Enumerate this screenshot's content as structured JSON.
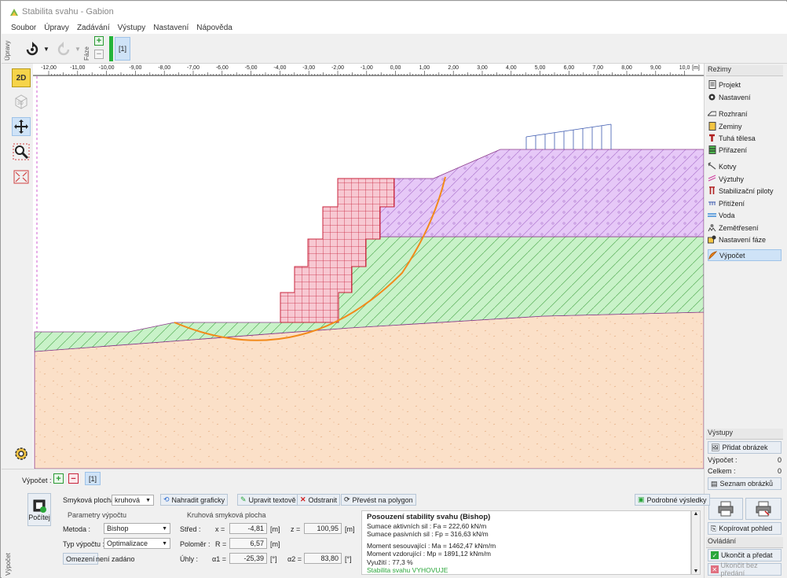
{
  "window": {
    "title": "Stabilita svahu - Gabion"
  },
  "menu": {
    "items": [
      "Soubor",
      "Úpravy",
      "Zadávání",
      "Výstupy",
      "Nastavení",
      "Nápověda"
    ]
  },
  "toolbar": {
    "side_label": "Úpravy",
    "phase_label": "Fáze",
    "phase_tab": "[1]"
  },
  "left_tools": {
    "btn_2d": "2D",
    "btn_3d": "3D"
  },
  "ruler": {
    "unit": "[m]",
    "ticks": [
      "-12,00",
      "-11,00",
      "-10,00",
      "-9,00",
      "-8,00",
      "-7,00",
      "-6,00",
      "-5,00",
      "-4,00",
      "-3,00",
      "-2,00",
      "-1,00",
      "0,00",
      "1,00",
      "2,00",
      "3,00",
      "4,00",
      "5,00",
      "6,00",
      "7,00",
      "8,00",
      "9,00",
      "10,0"
    ]
  },
  "modes": {
    "header": "Režimy",
    "items": [
      "Projekt",
      "Nastavení",
      "Rozhraní",
      "Zeminy",
      "Tuhá tělesa",
      "Přiřazení",
      "Kotvy",
      "Výztuhy",
      "Stabilizační piloty",
      "Přitížení",
      "Voda",
      "Zemětřesení",
      "Nastavení fáze",
      "Výpočet"
    ],
    "active": "Výpočet"
  },
  "outputs": {
    "header": "Výstupy",
    "add_image": "Přidat obrázek",
    "calc_label": "Výpočet :",
    "calc_value": "0",
    "total_label": "Celkem :",
    "total_value": "0",
    "image_list": "Seznam obrázků",
    "copy_view": "Kopírovat pohled"
  },
  "control": {
    "header": "Ovládání",
    "finish": "Ukončit a předat",
    "finish_no": "Ukončit bez předání"
  },
  "bottom": {
    "side_label": "Výpočet",
    "calc_tabs_label": "Výpočet :",
    "calc_tab": "[1]",
    "compute": "Počítej",
    "slip_surface_label": "Smyková plocha :",
    "slip_surface_value": "kruhová",
    "replace_graphic": "Nahradit graficky",
    "edit_text": "Upravit textově",
    "remove": "Odstranit",
    "to_polygon": "Převést na polygon",
    "detailed_results": "Podrobné výsledky",
    "params_title": "Parametry výpočtu",
    "method_label": "Metoda :",
    "method_value": "Bishop",
    "calc_type_label": "Typ výpočtu :",
    "calc_type_value": "Optimalizace",
    "limits_btn": "Omezení",
    "limits_value": "není zadáno",
    "circle_title": "Kruhová smyková plocha",
    "center_label": "Střed :",
    "x_label": "x =",
    "x_value": "-4,81",
    "x_unit": "[m]",
    "z_label": "z =",
    "z_value": "100,95",
    "z_unit": "[m]",
    "radius_label": "Poloměr :",
    "r_label": "R =",
    "r_value": "6,57",
    "r_unit": "[m]",
    "angles_label": "Úhly :",
    "a1_label": "α1 =",
    "a1_value": "-25,39",
    "a1_unit": "[°]",
    "a2_label": "α2 =",
    "a2_value": "83,80",
    "a2_unit": "[°]"
  },
  "results": {
    "title": "Posouzení stability svahu (Bishop)",
    "lines": [
      "Sumace aktivních sil :  Fa =   222,60 kN/m",
      "Sumace pasivních sil :  Fp =   316,63 kN/m",
      "Moment sesouvající :  Ma = 1462,47 kNm/m",
      "Moment vzdorující :  Mp = 1891,12 kNm/m",
      "Využití : 77,3  %"
    ],
    "verdict": "Stabilita svahu VYHOVUJE"
  },
  "colors": {
    "soil_top": "#e6c8f7",
    "soil_mid": "#c8f2c8",
    "soil_base": "#fbe0c8",
    "gabion": "#f7c8d2",
    "slip": "#f28a1a",
    "active": "#cfe3f7"
  }
}
